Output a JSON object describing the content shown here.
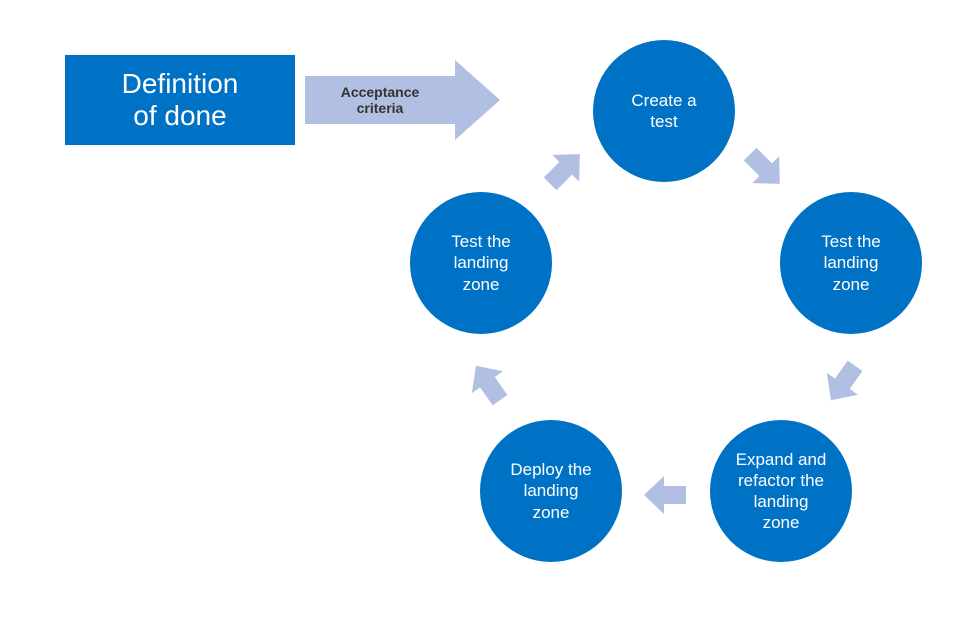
{
  "colors": {
    "primary": "#0072C6",
    "arrow": "#B1BFE2",
    "text_dark": "#333333",
    "text_light": "#FFFFFF"
  },
  "definition_box": {
    "line1": "Definition",
    "line2": "of done"
  },
  "big_arrow": {
    "line1": "Acceptance",
    "line2": "criteria"
  },
  "cycle": {
    "nodes": [
      {
        "id": "create-test",
        "line1": "Create a",
        "line2": "test",
        "line3": "",
        "line4": ""
      },
      {
        "id": "test-zone-right",
        "line1": "Test the",
        "line2": "landing",
        "line3": "zone",
        "line4": ""
      },
      {
        "id": "expand-refactor",
        "line1": "Expand and",
        "line2": "refactor the",
        "line3": "landing",
        "line4": "zone"
      },
      {
        "id": "deploy-zone",
        "line1": "Deploy the",
        "line2": "landing",
        "line3": "zone",
        "line4": ""
      },
      {
        "id": "test-zone-left",
        "line1": "Test the",
        "line2": "landing",
        "line3": "zone",
        "line4": ""
      }
    ]
  }
}
